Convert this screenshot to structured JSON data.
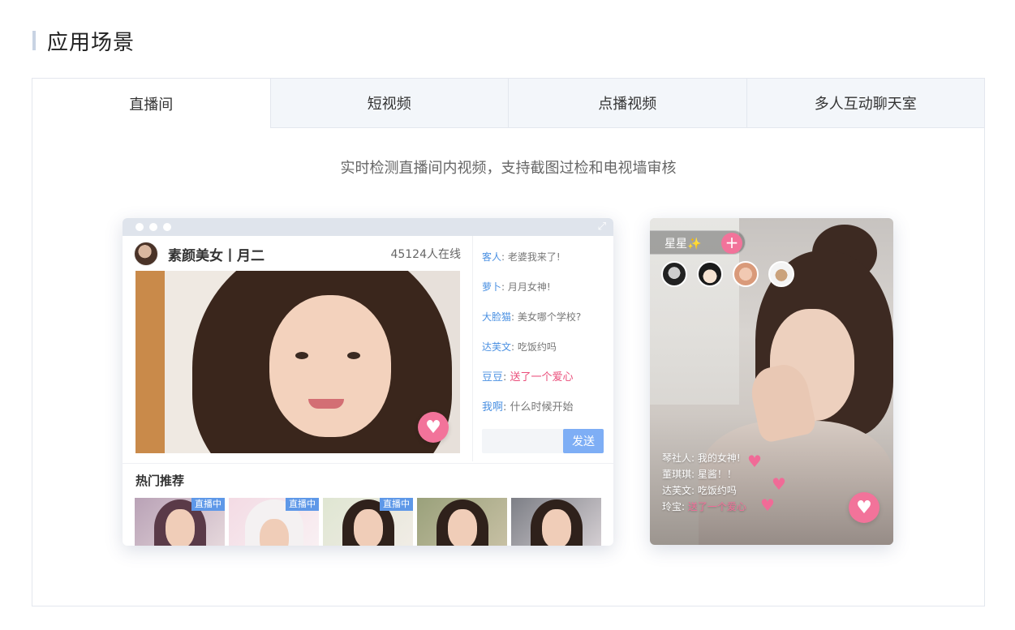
{
  "section": {
    "title": "应用场景"
  },
  "tabs": [
    {
      "label": "直播间",
      "active": true
    },
    {
      "label": "短视频",
      "active": false
    },
    {
      "label": "点播视频",
      "active": false
    },
    {
      "label": "多人互动聊天室",
      "active": false
    }
  ],
  "description": "实时检测直播间内视频，支持截图过检和电视墙审核",
  "live_window": {
    "host_name": "素颜美女丨月二",
    "viewer_count": "45124人在线",
    "heart_icon": "heart-icon",
    "chat": [
      {
        "nick": "客人",
        "sep": ": ",
        "content": "老婆我来了!",
        "gift": false
      },
      {
        "nick": "萝卜",
        "sep": ": ",
        "content": "月月女神!",
        "gift": false
      },
      {
        "nick": "大脸猫",
        "sep": ": ",
        "content": "美女哪个学校?",
        "gift": false
      },
      {
        "nick": "达芙文",
        "sep": ": ",
        "content": "吃饭约吗",
        "gift": false
      },
      {
        "nick": "豆豆",
        "sep": ": ",
        "content": "送了一个爱心",
        "gift": true
      },
      {
        "nick": "我啊",
        "sep": ": ",
        "content": "什么时候开始",
        "gift": false
      }
    ],
    "send_label": "发送",
    "recommend_title": "热门推荐",
    "live_badge": "直播中",
    "thumbnails": [
      {
        "live": true
      },
      {
        "live": true
      },
      {
        "live": true
      },
      {
        "live": false
      },
      {
        "live": false
      }
    ]
  },
  "phone": {
    "host_name": "星星✨",
    "follow_icon": "plus-icon",
    "chat": [
      {
        "nick": "琴社人",
        "sep": ": ",
        "content": "我的女神!",
        "gift": false
      },
      {
        "nick": "董琪琪",
        "sep": ": ",
        "content": "星酱！！",
        "gift": false
      },
      {
        "nick": "达芙文",
        "sep": ": ",
        "content": "吃饭约吗",
        "gift": false
      },
      {
        "nick": "玲宝",
        "sep": ": ",
        "content": "送了一个爱心",
        "gift": true
      }
    ]
  },
  "colors": {
    "accent_pink": "#f2739a",
    "link_blue": "#4a90e2",
    "send_button": "#7eaef5",
    "live_badge": "#5e98e8"
  }
}
